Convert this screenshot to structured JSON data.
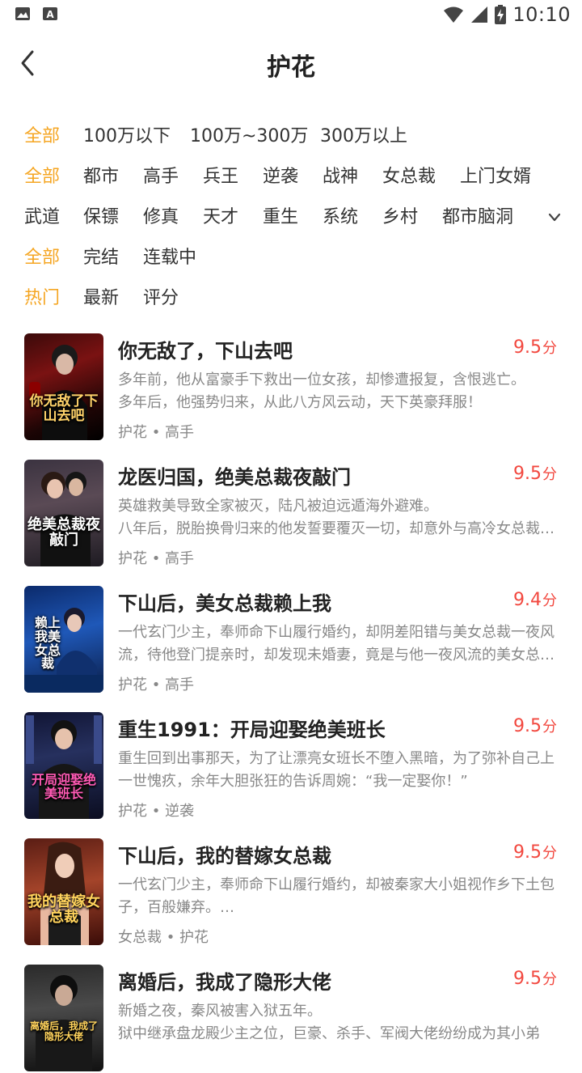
{
  "status_bar": {
    "time": "10:10"
  },
  "header": {
    "title": "护花"
  },
  "filters": {
    "word_count": [
      "全部",
      "100万以下",
      "100万~300万",
      "300万以上"
    ],
    "category_row1": [
      "全部",
      "都市",
      "高手",
      "兵王",
      "逆袭",
      "战神",
      "女总裁",
      "上门女婿"
    ],
    "category_row2": [
      "武道",
      "保镖",
      "修真",
      "天才",
      "重生",
      "系统",
      "乡村",
      "都市脑洞"
    ],
    "status": [
      "全部",
      "完结",
      "连载中"
    ],
    "sort": [
      "热门",
      "最新",
      "评分"
    ]
  },
  "colors": {
    "accent": "#F5A623",
    "score": "#F2483F"
  },
  "score_unit": "分",
  "books": [
    {
      "title": "你无敌了，下山去吧",
      "score": "9.5",
      "desc": [
        "多年前，他从富豪手下救出一位女孩，却惨遭报复，含恨逃亡。",
        "多年后，他强势归来，从此八方风云动，天下英豪拜服！"
      ],
      "tags": "护花 • 高手",
      "cover_text": "你无敌了下山去吧"
    },
    {
      "title": "龙医归国，绝美总裁夜敲门",
      "score": "9.5",
      "desc": [
        "英雄救美导致全家被灭，陆凡被迫远遁海外避难。",
        "八年后，脱胎换骨归来的他发誓要覆灭一切，却意外与高冷女总裁…"
      ],
      "tags": "护花 • 高手",
      "cover_text": "绝美总裁夜敲门"
    },
    {
      "title": "下山后，美女总裁赖上我",
      "score": "9.4",
      "desc": [
        "一代玄门少主，奉师命下山履行婚约，却阴差阳错与美女总裁一夜风",
        "流，待他登门提亲时，却发现未婚妻，竟是与他一夜风流的美女总…"
      ],
      "tags": "护花 • 高手",
      "cover_text": "赖上我美女总裁"
    },
    {
      "title": "重生1991：开局迎娶绝美班长",
      "score": "9.5",
      "desc": [
        "重生回到出事那天，为了让漂亮女班长不堕入黑暗，为了弥补自己上",
        "一世愧疚，余年大胆张狂的告诉周婉：“我一定娶你！”"
      ],
      "tags": "护花 • 逆袭",
      "cover_text": "开局迎娶绝美班长"
    },
    {
      "title": "下山后，我的替嫁女总裁",
      "score": "9.5",
      "desc": [
        "一代玄门少主，奉师命下山履行婚约，却被秦家大小姐视作乡下土包",
        "子，百般嫌弃。…"
      ],
      "tags": "女总裁 • 护花",
      "cover_text": "我的替嫁女总裁"
    },
    {
      "title": "离婚后，我成了隐形大佬",
      "score": "9.5",
      "desc": [
        "新婚之夜，秦风被害入狱五年。",
        "狱中继承盘龙殿少主之位，巨豪、杀手、军阀大佬纷纷成为其小弟"
      ],
      "tags": "",
      "cover_text": "离婚后，我成了隐形大佬"
    }
  ]
}
